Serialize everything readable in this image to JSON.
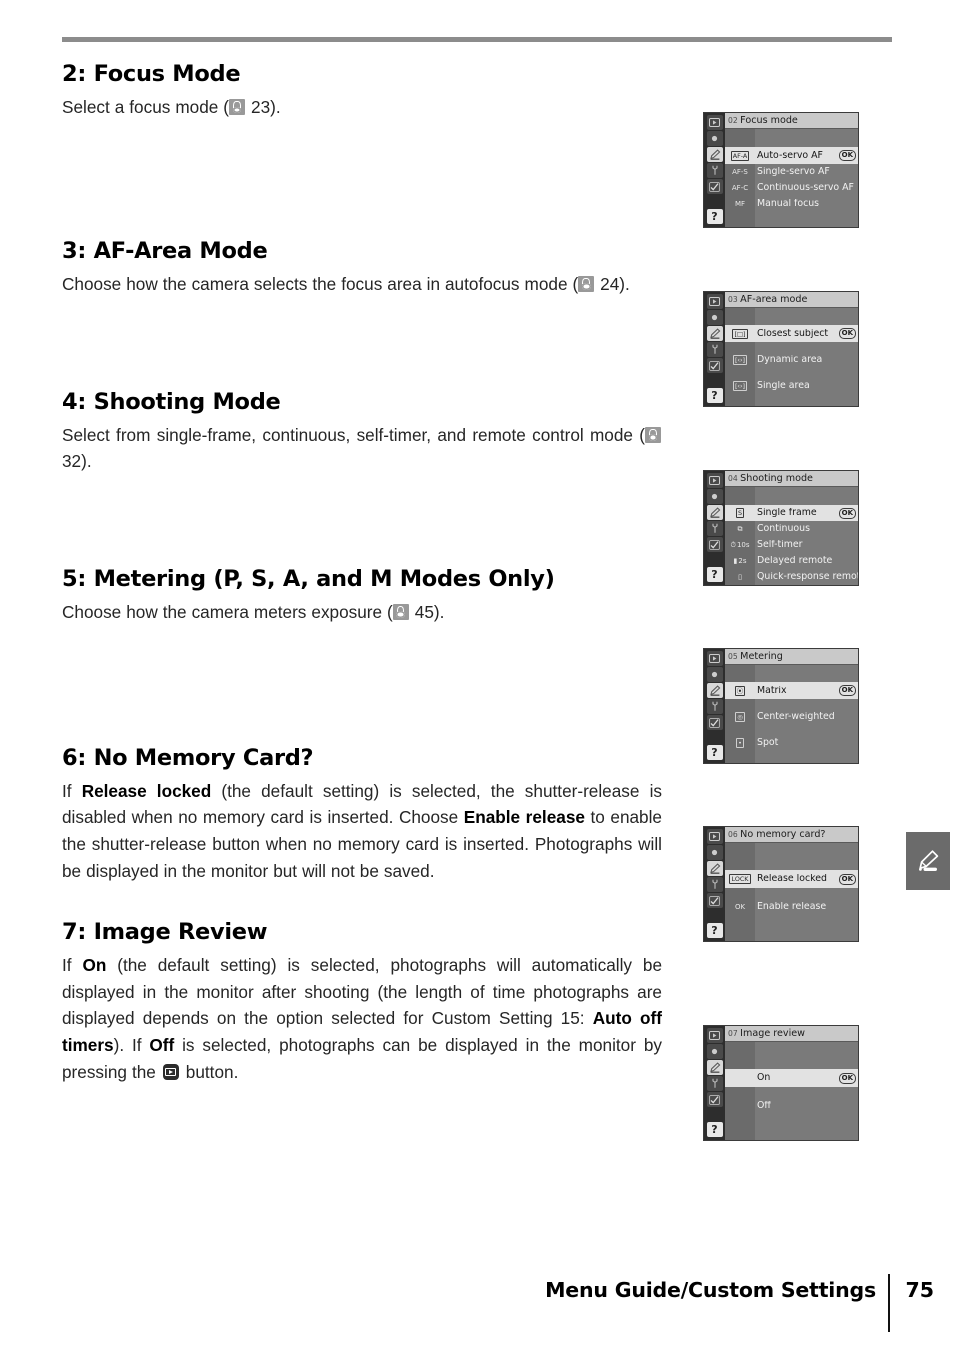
{
  "page": {
    "number": "75",
    "footer_title": "Menu Guide/Custom Settings",
    "chapter_tab_icon": "pencil-icon"
  },
  "sections": [
    {
      "id": "focus-mode",
      "title": "2: Focus Mode",
      "body_parts": [
        {
          "t": "text",
          "v": "Select a focus mode ("
        },
        {
          "t": "reficon",
          "v": "page-reference-icon"
        },
        {
          "t": "text",
          "v": " 23)."
        }
      ],
      "screenshot": {
        "number": "02",
        "title": "Focus mode",
        "rows": [
          {
            "tag": "",
            "label": "",
            "selected": false,
            "spacer": true
          },
          {
            "tag": "AF-A",
            "label": "Auto-servo AF",
            "selected": true,
            "ok": "OK"
          },
          {
            "tag": "AF-S",
            "label": "Single-servo AF",
            "selected": false
          },
          {
            "tag": "AF-C",
            "label": "Continuous-servo AF",
            "selected": false
          },
          {
            "tag": "MF",
            "label": "Manual focus",
            "selected": false
          }
        ]
      }
    },
    {
      "id": "af-area-mode",
      "title": "3: AF-Area Mode",
      "body_parts": [
        {
          "t": "text",
          "v": "Choose how the camera selects the focus area in autofocus mode ("
        },
        {
          "t": "reficon",
          "v": "page-reference-icon"
        },
        {
          "t": "text",
          "v": " 24)."
        }
      ],
      "screenshot": {
        "number": "03",
        "title": "AF-area mode",
        "rows": [
          {
            "tag": "",
            "label": "",
            "selected": false,
            "spacer": true
          },
          {
            "tag": "[□]",
            "label": "Closest subject",
            "selected": true,
            "ok": "OK"
          },
          {
            "tag": "",
            "label": "",
            "selected": false,
            "spacer": true
          },
          {
            "tag": "[‹›]",
            "label": "Dynamic area",
            "selected": false
          },
          {
            "tag": "",
            "label": "",
            "selected": false,
            "spacer": true
          },
          {
            "tag": "[‹›]",
            "label": "Single area",
            "selected": false
          }
        ]
      }
    },
    {
      "id": "shooting-mode",
      "title": "4: Shooting Mode",
      "body_parts": [
        {
          "t": "text",
          "v": "Select from single-frame, continuous, self-timer, and remote control mode ("
        },
        {
          "t": "reficon",
          "v": "page-reference-icon"
        },
        {
          "t": "text",
          "v": " 32)."
        }
      ],
      "screenshot": {
        "number": "04",
        "title": "Shooting mode",
        "rows": [
          {
            "tag": "",
            "label": "",
            "selected": false,
            "spacer": true
          },
          {
            "tag": "S",
            "label": "Single frame",
            "selected": true,
            "ok": "OK"
          },
          {
            "tag": "⧉",
            "label": "Continuous",
            "selected": false
          },
          {
            "tag": "10s",
            "label": "Self-timer",
            "selected": false
          },
          {
            "tag": "2s",
            "label": "Delayed remote",
            "selected": false
          },
          {
            "tag": "▯",
            "label": "Quick-response remote",
            "selected": false
          }
        ]
      }
    },
    {
      "id": "metering",
      "title": "5: Metering (P, S, A, and M Modes Only)",
      "body_parts": [
        {
          "t": "text",
          "v": "Choose how the camera meters exposure ("
        },
        {
          "t": "reficon",
          "v": "page-reference-icon"
        },
        {
          "t": "text",
          "v": " 45)."
        }
      ],
      "screenshot": {
        "number": "05",
        "title": "Metering",
        "rows": [
          {
            "tag": "",
            "label": "",
            "selected": false,
            "spacer": true
          },
          {
            "tag": "⦿",
            "label": "Matrix",
            "selected": true,
            "ok": "OK"
          },
          {
            "tag": "",
            "label": "",
            "selected": false,
            "spacer": true
          },
          {
            "tag": "◎",
            "label": "Center-weighted",
            "selected": false
          },
          {
            "tag": "",
            "label": "",
            "selected": false,
            "spacer": true
          },
          {
            "tag": "•",
            "label": "Spot",
            "selected": false
          }
        ]
      }
    },
    {
      "id": "no-memory-card",
      "title": "6: No Memory Card?",
      "body_parts": [
        {
          "t": "text",
          "v": "If "
        },
        {
          "t": "bold",
          "v": "Release locked"
        },
        {
          "t": "text",
          "v": " (the default setting) is selected, the shutter-release is disabled when no memory card is inserted.  Choose "
        },
        {
          "t": "bold",
          "v": "Enable release"
        },
        {
          "t": "text",
          "v": " to enable the shutter-release button when no memory card is inserted.  Photographs will be displayed in the monitor but will not be saved."
        }
      ],
      "screenshot": {
        "number": "06",
        "title": "No memory card?",
        "rows": [
          {
            "tag": "",
            "label": "",
            "selected": false,
            "spacer": true
          },
          {
            "tag": "",
            "label": "",
            "selected": false,
            "spacer": true
          },
          {
            "tag": "LOCK",
            "label": "Release locked",
            "selected": true,
            "ok": "OK"
          },
          {
            "tag": "",
            "label": "",
            "selected": false,
            "spacer": true
          },
          {
            "tag": "OK",
            "label": "Enable release",
            "selected": false
          }
        ]
      }
    },
    {
      "id": "image-review",
      "title": "7: Image Review",
      "body_parts": [
        {
          "t": "text",
          "v": "If "
        },
        {
          "t": "bold",
          "v": "On"
        },
        {
          "t": "text",
          "v": " (the default setting) is selected, photographs will automatically be displayed in the monitor after shooting (the length of time photographs are displayed depends on the option selected for Custom Setting 15: "
        },
        {
          "t": "bold",
          "v": "Auto off timers"
        },
        {
          "t": "text",
          "v": ").  If "
        },
        {
          "t": "bold",
          "v": "Off"
        },
        {
          "t": "text",
          "v": " is selected, photographs can be displayed in the monitor by pressing the "
        },
        {
          "t": "playicon",
          "v": "playback-button-icon"
        },
        {
          "t": "text",
          "v": " button."
        }
      ],
      "screenshot": {
        "number": "07",
        "title": "Image review",
        "rows": [
          {
            "tag": "",
            "label": "",
            "selected": false,
            "spacer": true
          },
          {
            "tag": "",
            "label": "",
            "selected": false,
            "spacer": true
          },
          {
            "tag": "",
            "label": "On",
            "selected": true,
            "ok": "OK"
          },
          {
            "tag": "",
            "label": "",
            "selected": false,
            "spacer": true
          },
          {
            "tag": "",
            "label": "Off",
            "selected": false
          }
        ]
      }
    }
  ],
  "screenshot_sidebar": {
    "icons": [
      "playback-icon",
      "shooting-menu-icon",
      "custom-settings-pencil-icon",
      "setup-wrench-icon",
      "retouch-icon",
      "help-question-icon"
    ],
    "selected_index": 2,
    "help_label": "?"
  },
  "colors": {
    "rule": "#8c8c8c",
    "tab_background": "#6b6b6b",
    "screen_background": "#7a7a7a",
    "screen_header": "#c9c9c9",
    "selection": "#e2e2e2"
  }
}
